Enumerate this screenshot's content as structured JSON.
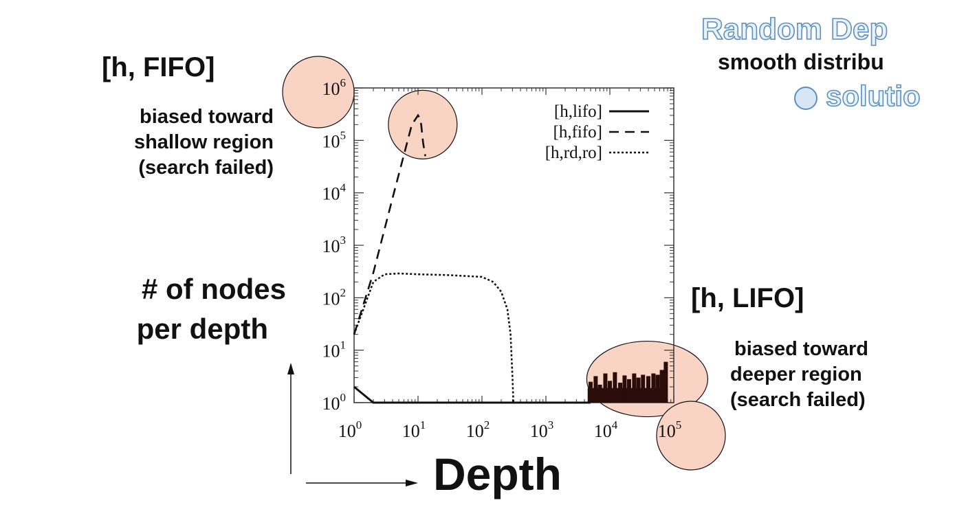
{
  "chart_data": {
    "type": "line",
    "xscale": "log",
    "yscale": "log",
    "xlim": [
      1,
      100000
    ],
    "ylim": [
      1,
      1000000
    ],
    "x_ticks": [
      1,
      10,
      100,
      1000,
      10000,
      100000
    ],
    "y_ticks": [
      1,
      10,
      100,
      1000,
      10000,
      100000,
      1000000
    ],
    "legend_position": "top-right",
    "series": [
      {
        "name": "[h,lifo]",
        "style": "solid",
        "x": [
          1,
          2,
          10,
          100,
          1000,
          3000,
          5000
        ],
        "y": [
          2,
          1,
          1,
          1,
          1,
          1,
          1
        ]
      },
      {
        "name": "[h,fifo]",
        "style": "dashed",
        "x": [
          1,
          2,
          4,
          8,
          10,
          11,
          12,
          13
        ],
        "y": [
          20,
          300,
          8000,
          200000,
          300000,
          250000,
          90000,
          50000
        ]
      },
      {
        "name": "[h,rd,ro]",
        "style": "dotted",
        "x": [
          1,
          2,
          3,
          5,
          10,
          30,
          100,
          150,
          200,
          250,
          280,
          300,
          310
        ],
        "y": [
          20,
          200,
          280,
          290,
          280,
          270,
          250,
          200,
          130,
          60,
          20,
          3,
          1
        ]
      }
    ],
    "lifo_spikes": [
      {
        "x": 5000,
        "y": 2.5
      },
      {
        "x": 6000,
        "y": 3.2
      },
      {
        "x": 7000,
        "y": 2.2
      },
      {
        "x": 8500,
        "y": 3.6
      },
      {
        "x": 10000,
        "y": 2.6
      },
      {
        "x": 12000,
        "y": 3.8
      },
      {
        "x": 14500,
        "y": 2.4
      },
      {
        "x": 17000,
        "y": 3.3
      },
      {
        "x": 20000,
        "y": 2.8
      },
      {
        "x": 24000,
        "y": 3.6
      },
      {
        "x": 28000,
        "y": 3.0
      },
      {
        "x": 33000,
        "y": 3.4
      },
      {
        "x": 40000,
        "y": 3.2
      },
      {
        "x": 48000,
        "y": 3.6
      },
      {
        "x": 56000,
        "y": 3.4
      },
      {
        "x": 65000,
        "y": 4.2
      },
      {
        "x": 75000,
        "y": 6.0
      }
    ],
    "highlight_circles": [
      "y-tick-1e6",
      "fifo-peak",
      "lifo-spike-region",
      "x-tick-1e5"
    ],
    "highlight_color": "#f9d3c4"
  },
  "annotations": {
    "fifo_title": "[h, FIFO]",
    "fifo_note": [
      "biased toward",
      "shallow region",
      "(search failed)"
    ],
    "lifo_title": "[h, LIFO]",
    "lifo_note": [
      "biased toward",
      "deeper region",
      "(search failed)"
    ],
    "ylabel": [
      "# of nodes",
      "per depth"
    ],
    "xlabel": "Depth",
    "random_title": "Random Dep",
    "random_sub": "smooth distribu",
    "random_bullet": "solutio"
  }
}
